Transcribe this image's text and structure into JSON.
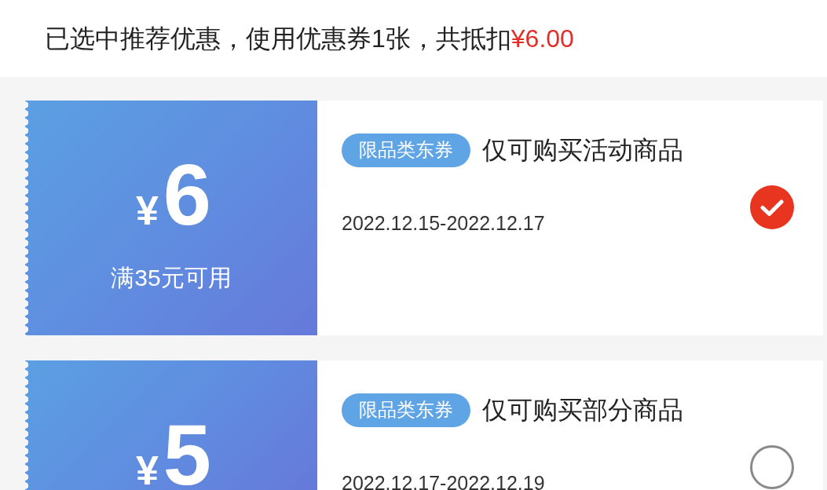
{
  "summary": {
    "text": "已选中推荐优惠，使用优惠券1张，共抵扣",
    "discount": "¥6.00"
  },
  "coupons": [
    {
      "currency": "¥",
      "amount": "6",
      "condition": "满35元可用",
      "tag": "限品类东券",
      "title": "仅可购买活动商品",
      "validity": "2022.12.15-2022.12.17",
      "selected": true
    },
    {
      "currency": "¥",
      "amount": "5",
      "tag": "限品类东券",
      "title": "仅可购买部分商品",
      "validity": "2022.12.17-2022.12.19",
      "selected": false
    }
  ]
}
